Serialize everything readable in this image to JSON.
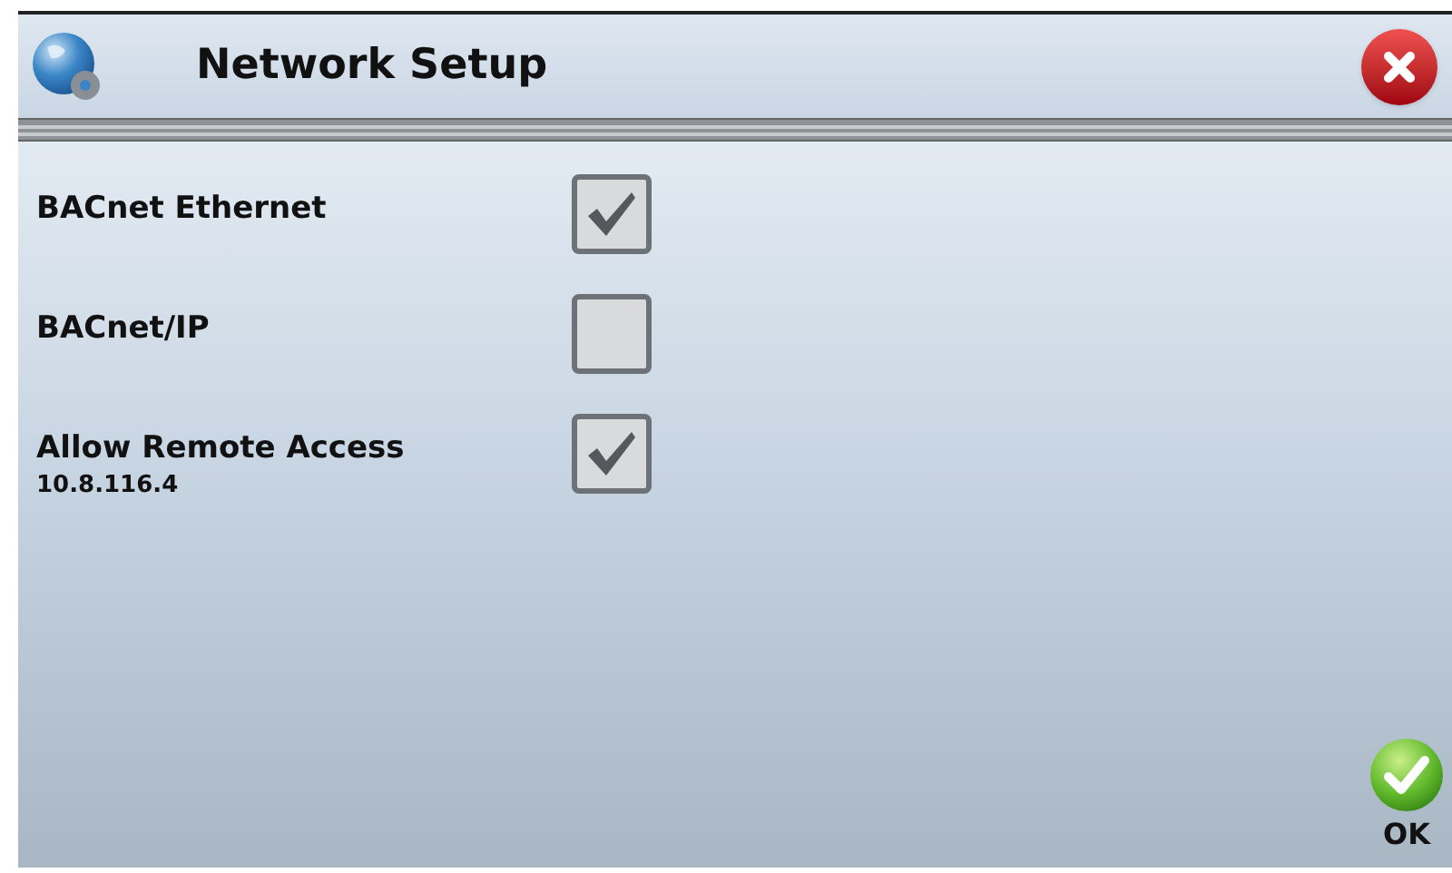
{
  "window": {
    "title": "Network Setup"
  },
  "options": [
    {
      "label": "BACnet Ethernet",
      "checked": true
    },
    {
      "label": "BACnet/IP",
      "checked": false
    },
    {
      "label": "Allow Remote Access",
      "detail": "10.8.116.4",
      "checked": true
    }
  ],
  "ok_button": {
    "label": "OK"
  }
}
